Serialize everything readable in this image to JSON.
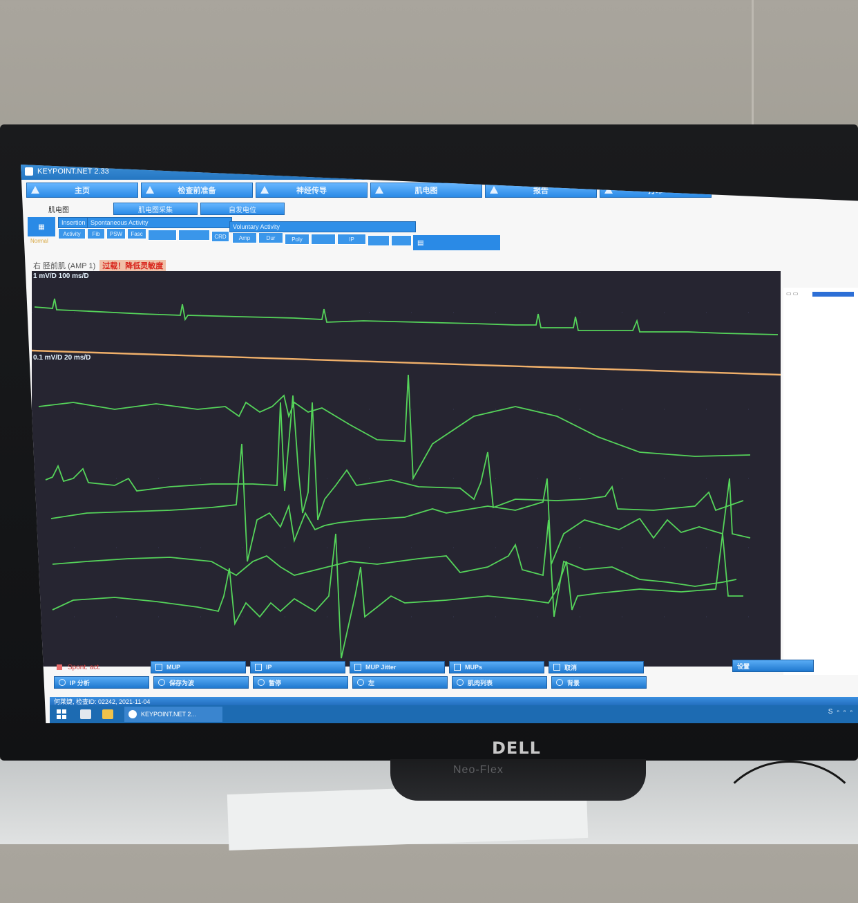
{
  "app": {
    "title": "KEYPOINT.NET 2.33"
  },
  "nav": {
    "tabs": [
      {
        "label": "主页"
      },
      {
        "label": "检查前准备"
      },
      {
        "label": "神经传导"
      },
      {
        "label": "肌电图"
      },
      {
        "label": "报告"
      },
      {
        "label": "打印"
      }
    ]
  },
  "subnav": {
    "label": "肌电图",
    "tabs": [
      {
        "label": "肌电图采集"
      },
      {
        "label": "自发电位"
      }
    ]
  },
  "options": {
    "normal": "Normal",
    "groups": [
      "Insertion",
      "Spontaneous Activity",
      "Voluntary Activity"
    ],
    "buttons": [
      "Activity",
      "Fib",
      "PSW",
      "Fasc",
      "",
      "",
      "CRD",
      "Amp",
      "Dur",
      "Poly",
      "",
      "IP",
      "",
      ""
    ]
  },
  "muscle": {
    "name": "右 胫前肌 (AMP 1)",
    "warning": "过载！降低灵敏度"
  },
  "traces": {
    "scale_top": "1 mV/D 100 ms/D",
    "scale_bottom": "0.1 mV/D 20 ms/D"
  },
  "bottom_buttons": {
    "row1": [
      {
        "type": "spont",
        "label": "Spont. act."
      },
      {
        "type": "check",
        "label": "MUP"
      },
      {
        "type": "check",
        "label": "IP"
      },
      {
        "type": "check",
        "label": "MUP Jitter"
      },
      {
        "type": "check",
        "label": "MUPs"
      },
      {
        "type": "check",
        "label": "取消"
      }
    ],
    "row2": [
      {
        "type": "radio",
        "label": "IP 分析"
      },
      {
        "type": "radio",
        "label": "保存为波"
      },
      {
        "type": "radio",
        "label": "暂停"
      },
      {
        "type": "radio",
        "label": "左"
      },
      {
        "type": "radio",
        "label": "肌肉列表"
      },
      {
        "type": "radio",
        "label": "背景"
      }
    ],
    "right_label": "设置"
  },
  "status": {
    "patient": "何莱婕, 检查ID: 02242, 2021-11-04"
  },
  "taskbar": {
    "task_label": "KEYPOINT.NET 2..."
  },
  "monitor": {
    "brand": "DELL",
    "stand_label": "Neo-Flex"
  }
}
